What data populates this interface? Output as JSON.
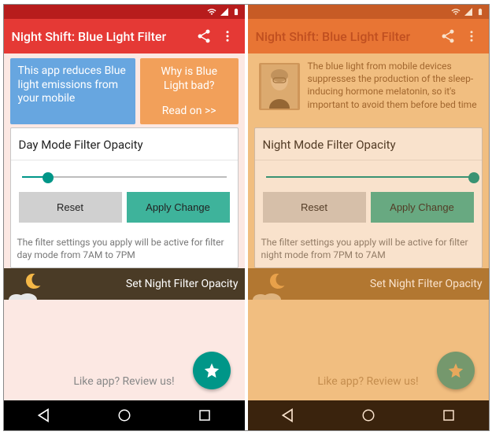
{
  "left": {
    "app_title": "Night Shift: Blue Light Filter",
    "info_blue": "This app reduces Blue light emissions from your mobile",
    "info_orange_q": "Why is Blue Light bad?",
    "info_orange_link": "Read on >>",
    "card_title": "Day Mode Filter Opacity",
    "reset": "Reset",
    "apply": "Apply Change",
    "help": "The filter settings you apply will be active for filter day mode from 7AM to 7PM",
    "night_bar": "Set Night Filter Opacity",
    "review": "Like app? Review us!"
  },
  "right": {
    "app_title": "Night Shift: Blue Light Filter",
    "info_text": "The blue light from mobile devices suppresses the production of the sleep-inducing hormone melatonin, so it's important to avoid them before bed time",
    "card_title": "Night Mode Filter Opacity",
    "reset": "Reset",
    "apply": "Apply Change",
    "help": "The filter settings you apply will be active for filter night mode from 7PM to 7AM",
    "night_bar": "Set Night Filter Opacity",
    "review": "Like app? Review us!"
  }
}
